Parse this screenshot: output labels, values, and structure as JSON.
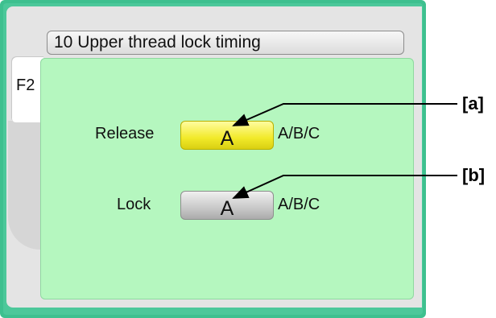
{
  "tab": {
    "label": "F2"
  },
  "header": {
    "title": "10 Upper thread lock timing"
  },
  "settings": [
    {
      "label": "Release",
      "value": "A",
      "options": "A/B/C"
    },
    {
      "label": "Lock",
      "value": "A",
      "options": "A/B/C"
    }
  ],
  "callouts": [
    "[a]",
    "[b]"
  ],
  "colors": {
    "frame": "#3ec08f",
    "content_bg": "#b5f7bf",
    "selected_button": "#f2ea2a",
    "normal_button": "#c8c8c8"
  }
}
